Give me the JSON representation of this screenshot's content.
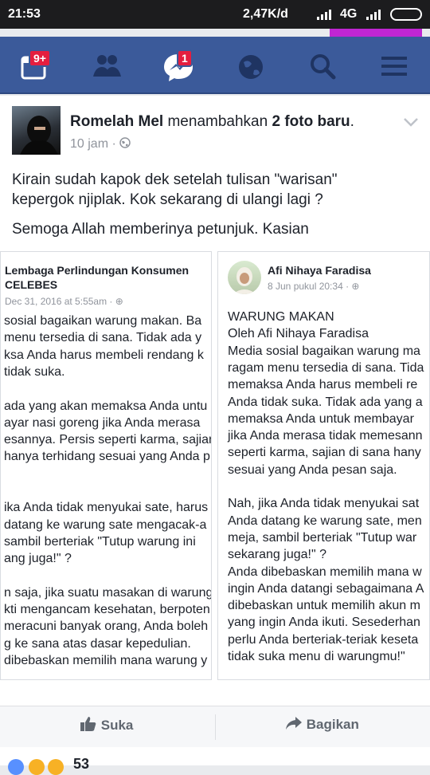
{
  "status": {
    "time": "21:53",
    "net_speed": "2,47K/d",
    "network": "4G"
  },
  "nav": {
    "icons": [
      "friend-requests-calendar-icon",
      "friends-icon",
      "messenger-icon",
      "globe-icon",
      "search-icon",
      "menu-icon"
    ],
    "notifications_badge": "9+",
    "messages_badge": "1"
  },
  "post": {
    "author": "Romelah Mel",
    "action": "menambahkan",
    "object": "2 foto baru",
    "period": ".",
    "time": "10 jam",
    "text1_line1": "Kirain sudah kapok dek setelah tulisan \"warisan\"",
    "text1_line2": "kepergok njiplak. Kok sekarang di ulangi lagi ?",
    "text2": "Semoga Allah memberinya petunjuk. Kasian"
  },
  "photo_left": {
    "name_line1": "Lembaga Perlindungan Konsumen",
    "name_line2": "CELEBES",
    "date": "Dec 31, 2016 at 5:55am",
    "lines": [
      "sosial bagaikan warung makan. Ba",
      "menu tersedia di sana. Tidak ada y",
      "ksa Anda harus membeli rendang k",
      "tidak suka.",
      "",
      "ada yang akan memaksa Anda untu",
      "ayar nasi goreng jika Anda merasa",
      "esannya. Persis seperti karma, sajian",
      "hanya terhidang sesuai yang Anda p",
      "",
      "",
      "ika Anda tidak menyukai sate, harus",
      "datang ke warung sate mengacak-a",
      "sambil berteriak \"Tutup warung ini",
      "ang juga!\" ?",
      "",
      "n saja, jika suatu masakan di warung",
      "kti mengancam kesehatan, berpoten",
      "meracuni banyak orang, Anda boleh",
      "g ke sana atas dasar kepedulian.",
      "dibebaskan memilih mana warung y"
    ]
  },
  "photo_right": {
    "name": "Afi Nihaya Faradisa",
    "date": "8 Jun pukul 20:34",
    "lines": [
      "WARUNG MAKAN",
      "Oleh Afi Nihaya Faradisa",
      "Media sosial bagaikan warung ma",
      "ragam menu tersedia di sana. Tida",
      "memaksa Anda harus membeli re",
      "Anda tidak suka. Tidak ada yang a",
      "memaksa Anda untuk membayar",
      "jika Anda merasa tidak memesann",
      "seperti karma, sajian di sana hany",
      "sesuai yang Anda pesan saja.",
      "",
      "Nah, jika Anda tidak menyukai sat",
      "Anda datang ke warung sate, men",
      "meja, sambil berteriak \"Tutup war",
      "sekarang juga!\" ?",
      "Anda dibebaskan memilih mana w",
      "ingin Anda datangi sebagaimana A",
      "dibebaskan untuk memilih akun m",
      "yang ingin Anda ikuti. Sesederhan",
      "perlu Anda berteriak-teriak keseta",
      "tidak suka menu di warungmu!\""
    ]
  },
  "actions": {
    "like": "Suka",
    "share": "Bagikan"
  },
  "reactions": {
    "count": "53"
  },
  "colors": {
    "nav": "#3b5a9a",
    "badge": "#e41e3f",
    "text": "#1d2129",
    "meta": "#90949c"
  }
}
